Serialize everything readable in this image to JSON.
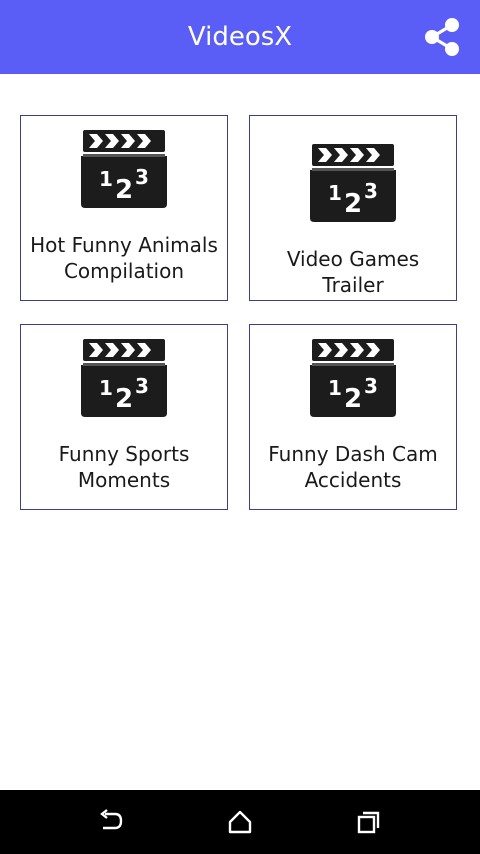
{
  "app": {
    "title": "VideosX",
    "accent_color": "#5a5ef7"
  },
  "toolbar": {
    "share_icon": "share-icon"
  },
  "videos": [
    {
      "title": "Hot Funny Animals Compilation",
      "icon": "clapperboard-icon"
    },
    {
      "title": "Video Games Trailer",
      "icon": "clapperboard-icon"
    },
    {
      "title": "Funny Sports Moments",
      "icon": "clapperboard-icon"
    },
    {
      "title": "Funny Dash Cam Accidents",
      "icon": "clapperboard-icon"
    }
  ],
  "clapper_digits": {
    "one": "1",
    "two": "2",
    "three": "3"
  },
  "navbar": {
    "back_icon": "back-icon",
    "home_icon": "home-icon",
    "recents_icon": "recents-icon"
  }
}
